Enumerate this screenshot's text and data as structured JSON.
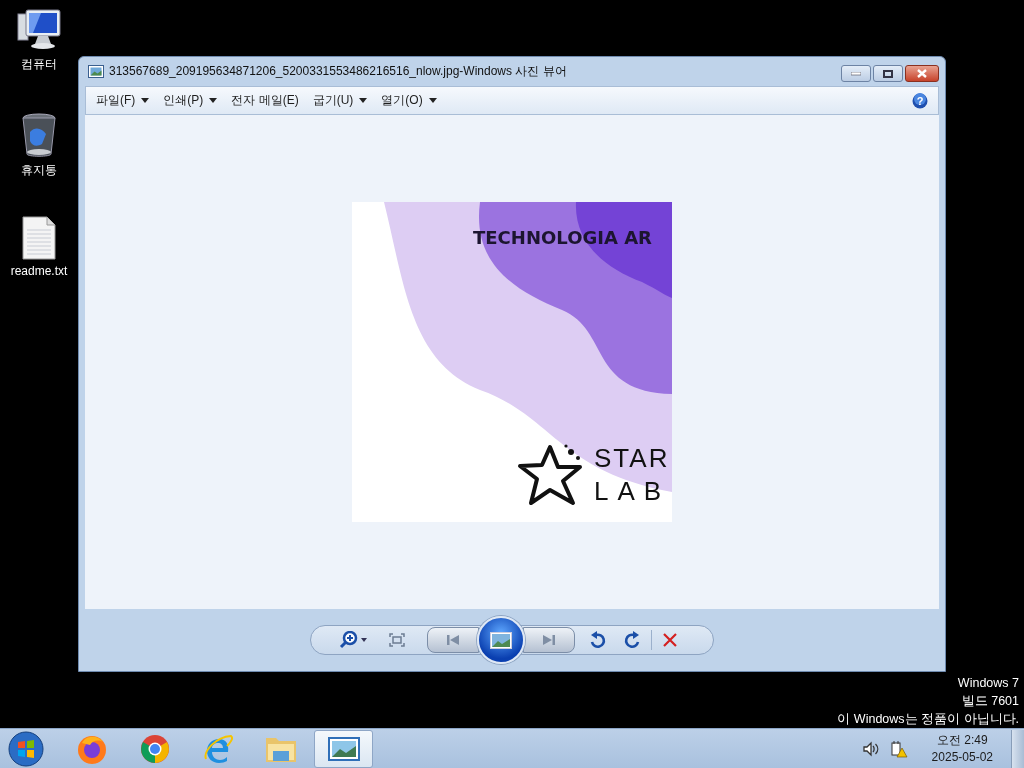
{
  "desktop_icons": [
    {
      "label": "컴퓨터",
      "kind": "computer"
    },
    {
      "label": "휴지통",
      "kind": "recycle"
    },
    {
      "label": "readme.txt",
      "kind": "text"
    }
  ],
  "window": {
    "title": "313567689_209195634871206_5200331553486216516_nlow.jpg-Windows 사진 뷰어",
    "menu": [
      {
        "label": "파일(F)",
        "has_dropdown": true
      },
      {
        "label": "인쇄(P)",
        "has_dropdown": true
      },
      {
        "label": "전자 메일(E)",
        "has_dropdown": false
      },
      {
        "label": "굽기(U)",
        "has_dropdown": true
      },
      {
        "label": "열기(O)",
        "has_dropdown": true
      }
    ],
    "help": "?",
    "image": {
      "headline": "TECHNOLOGIA AR",
      "logo_lines": [
        "STAR",
        "LAB"
      ]
    }
  },
  "notice": [
    "Windows 7",
    "빌드 7601",
    "이 Windows는 정품이 아닙니다."
  ],
  "taskbar": {
    "apps": [
      {
        "kind": "firefox",
        "selected": false
      },
      {
        "kind": "chrome",
        "selected": false
      },
      {
        "kind": "ie",
        "selected": false
      },
      {
        "kind": "explorer",
        "selected": false
      },
      {
        "kind": "photos",
        "selected": true
      }
    ],
    "clock": {
      "time": "오전 2:49",
      "date": "2025-05-02"
    }
  }
}
